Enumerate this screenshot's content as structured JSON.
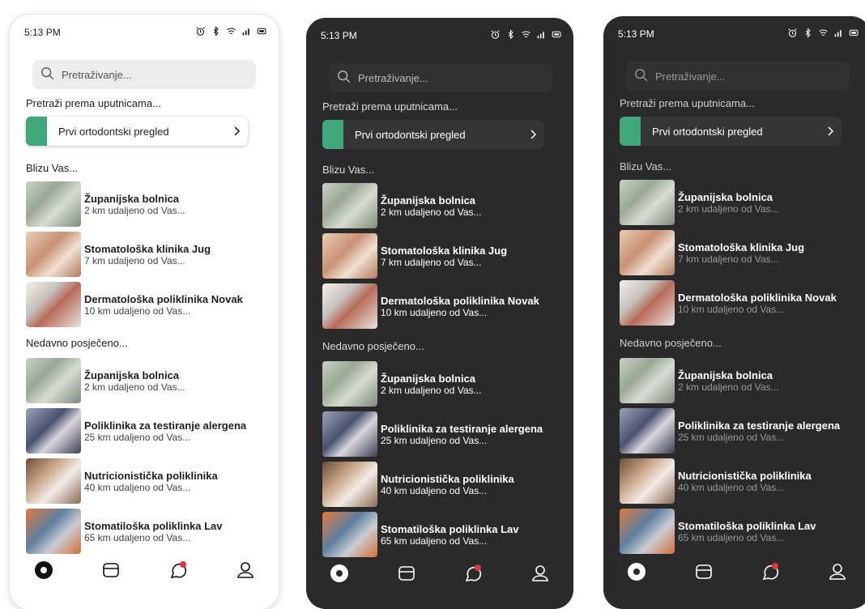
{
  "status_time": "5:13 PM",
  "search_placeholder": "Pretraživanje...",
  "referrals_heading": "Pretraži prema uputnicama...",
  "referral": {
    "label": "Prvi ortodontski pregled",
    "color": "#3fa77a"
  },
  "nearby_heading": "Blizu Vas...",
  "nearby": [
    {
      "name": "Županijska bolnica",
      "distance": "2 km udaljeno od Vas...",
      "image": "hospital"
    },
    {
      "name": "Stomatološka klinika Jug",
      "distance": "7 km udaljeno od Vas...",
      "image": "dental"
    },
    {
      "name": "Dermatološka poliklinika Novak",
      "distance": "10 km udaljeno od Vas...",
      "image": "derm"
    }
  ],
  "recent_heading": "Nedavno posječeno...",
  "recent": [
    {
      "name": "Županijska bolnica",
      "distance": "2 km udaljeno od Vas...",
      "image": "hospital"
    },
    {
      "name": "Poliklinika za testiranje alergena",
      "distance": "25 km udaljeno od Vas...",
      "image": "allergen"
    },
    {
      "name": "Nutricionistička poliklinika",
      "distance": "40 km udaljeno od Vas...",
      "image": "nutri"
    },
    {
      "name": "Stomatiloška poliklinka Lav",
      "distance": "65 km udaljeno od Vas...",
      "image": "lav"
    }
  ],
  "nav": [
    {
      "icon": "home-icon"
    },
    {
      "icon": "wallet-icon"
    },
    {
      "icon": "chat-icon",
      "badge_color": "#e5343a"
    },
    {
      "icon": "profile-icon"
    }
  ],
  "themes": [
    "light",
    "dark",
    "muted"
  ]
}
